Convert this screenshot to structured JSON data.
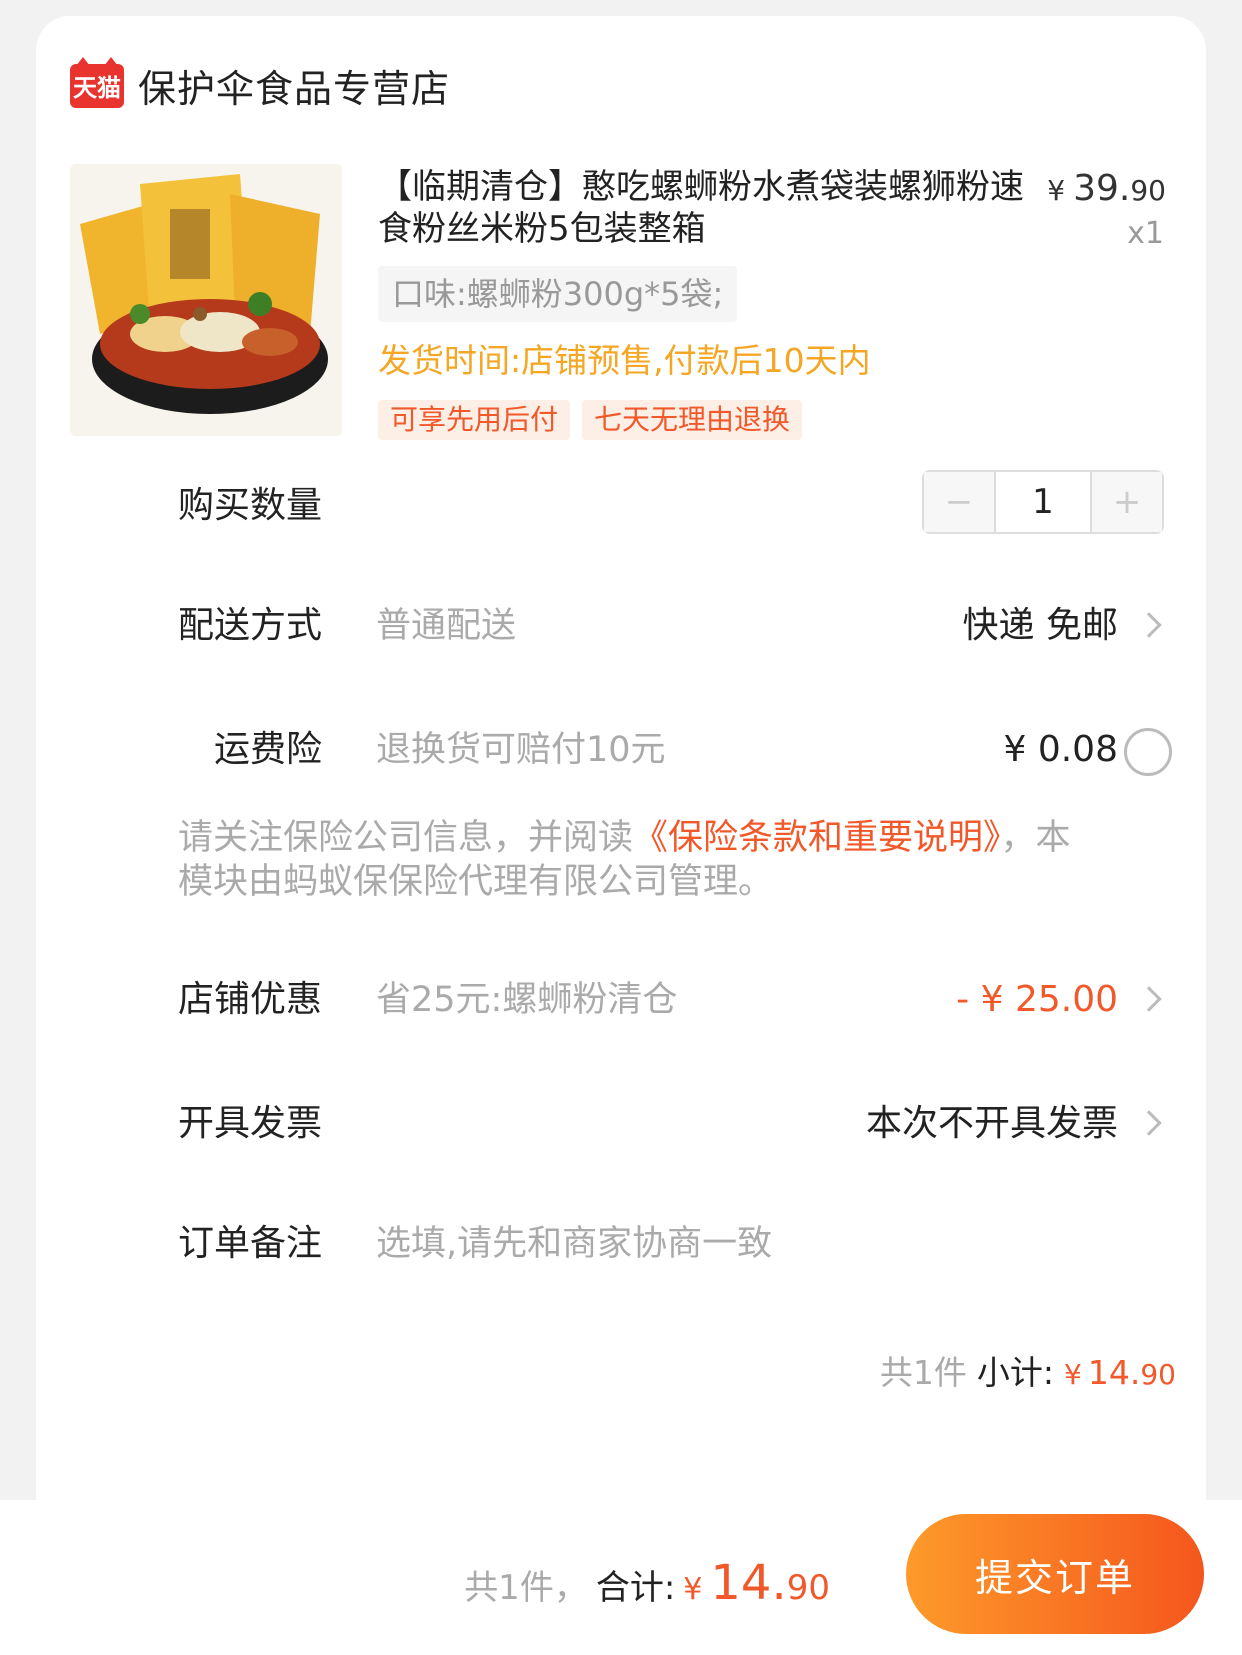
{
  "shop": {
    "logo_text": "天猫",
    "name": "保护伞食品专营店"
  },
  "product": {
    "title": "【临期清仓】憨吃螺蛳粉水煮袋装螺狮粉速食粉丝米粉5包装整箱",
    "price_symbol": "¥",
    "price_int": "39.",
    "price_dec": "90",
    "quantity_label": "x1",
    "sku": "口味:螺蛳粉300g*5袋;",
    "ship_time": "发货时间:店铺预售,付款后10天内",
    "tags": [
      "可享先用后付",
      "七天无理由退换"
    ]
  },
  "quantity": {
    "label": "购买数量",
    "minus": "−",
    "value": "1",
    "plus": "+"
  },
  "delivery": {
    "label": "配送方式",
    "desc": "普通配送",
    "value": "快递 免邮"
  },
  "insurance": {
    "label": "运费险",
    "desc": "退换货可赔付10元",
    "value": "¥ 0.08"
  },
  "notice": {
    "prefix": "请关注保险公司信息，并阅读",
    "link": "《保险条款和重要说明》",
    "suffix": "，本模块由蚂蚁保保险代理有限公司管理。"
  },
  "discount": {
    "label": "店铺优惠",
    "desc": "省25元:螺蛳粉清仓",
    "value": "- ¥ 25.00"
  },
  "invoice": {
    "label": "开具发票",
    "value": "本次不开具发票"
  },
  "remark": {
    "label": "订单备注",
    "placeholder": "选填,请先和商家协商一致"
  },
  "subtotal": {
    "count": "共1件",
    "label": "小计:",
    "symbol": "¥",
    "int": "14.",
    "dec": "90"
  },
  "footer": {
    "count": "共1件，",
    "label": "合计:",
    "symbol": "¥",
    "int": "14.",
    "dec": "90",
    "submit": "提交订单"
  },
  "colors": {
    "accent": "#f1582a",
    "ship_time": "#f5a623",
    "tmall_red": "#e8332f"
  }
}
